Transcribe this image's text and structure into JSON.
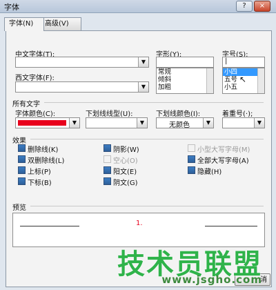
{
  "window": {
    "title": "字体",
    "help_glyph": "?",
    "close_glyph": "×"
  },
  "tabs": [
    {
      "label": "字体(N)"
    },
    {
      "label": "高级(V)"
    }
  ],
  "fonts": {
    "cn_font_label": "中文字体(T):",
    "cn_font_value": "",
    "west_font_label": "西文字体(F):",
    "west_font_value": "",
    "style_label": "字形(Y):",
    "style_value": "",
    "style_items": [
      "常规",
      "倾斜",
      "加粗"
    ],
    "size_label": "字号(S):",
    "size_value": "|",
    "size_items": [
      "小四",
      "五号",
      "小五"
    ],
    "size_selected_index": 0
  },
  "all_text": {
    "heading": "所有文字",
    "font_color_label": "字体颜色(C):",
    "font_color_value_hex": "#e8001c",
    "underline_style_label": "下划线线型(U):",
    "underline_style_value": "",
    "underline_color_label": "下划线颜色(I):",
    "underline_color_value": "无颜色",
    "emphasis_label": "着重号(·);",
    "emphasis_value": ""
  },
  "effects": {
    "heading": "效果",
    "items": [
      {
        "label": "删除线(K)",
        "checked": true,
        "disabled": false
      },
      {
        "label": "双删除线(L)",
        "checked": true,
        "disabled": false
      },
      {
        "label": "上标(P)",
        "checked": true,
        "disabled": false
      },
      {
        "label": "下标(B)",
        "checked": true,
        "disabled": false
      },
      {
        "label": "阴影(W)",
        "checked": true,
        "disabled": false
      },
      {
        "label": "空心(O)",
        "checked": false,
        "disabled": true
      },
      {
        "label": "阳文(E)",
        "checked": true,
        "disabled": false
      },
      {
        "label": "阴文(G)",
        "checked": true,
        "disabled": false
      },
      {
        "label": "小型大写字母(M)",
        "checked": false,
        "disabled": true
      },
      {
        "label": "全部大写字母(A)",
        "checked": true,
        "disabled": false
      },
      {
        "label": "隐藏(H)",
        "checked": true,
        "disabled": false
      }
    ]
  },
  "preview": {
    "heading": "预览",
    "sample_text": "1.",
    "sample_color_hex": "#e8001c"
  },
  "bottom": {
    "button_fragment": "消"
  },
  "watermark": {
    "main": "技术员联盟",
    "url": "www.jsgho.com"
  }
}
